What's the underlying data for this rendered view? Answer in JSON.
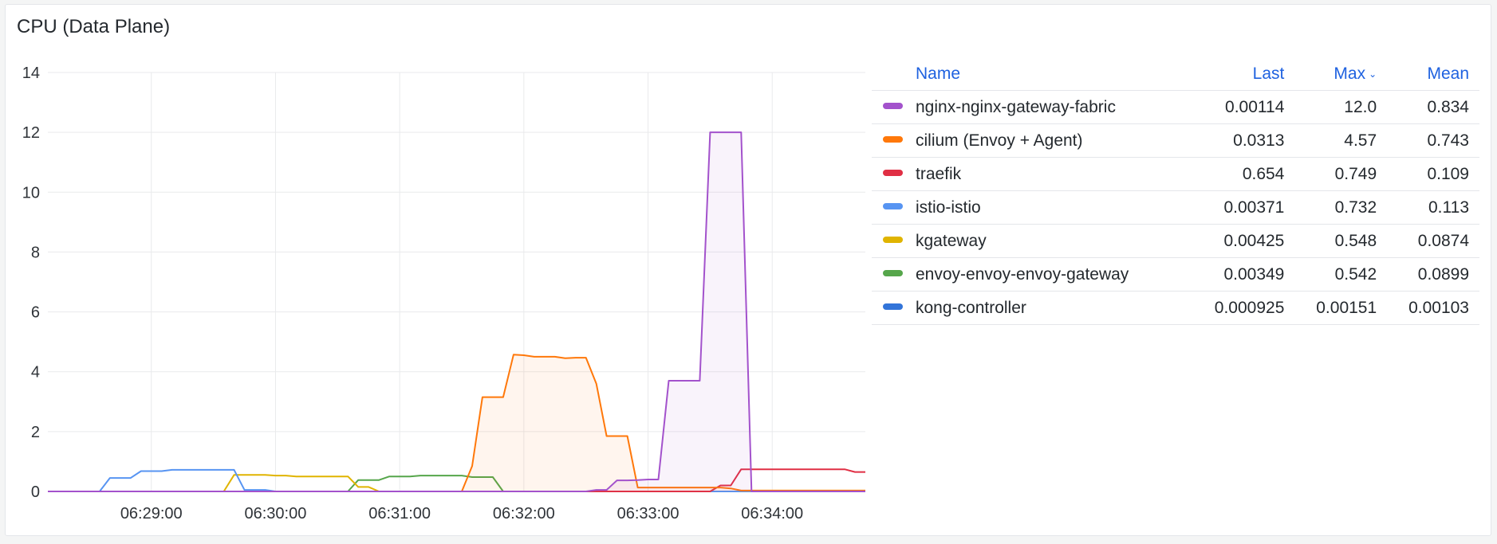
{
  "panel": {
    "title": "CPU (Data Plane)"
  },
  "legend": {
    "headers": {
      "name": "Name",
      "last": "Last",
      "max": "Max",
      "mean": "Mean"
    },
    "sort_icon": "chevron-down-icon"
  },
  "chart_data": {
    "type": "line",
    "title": "CPU (Data Plane)",
    "xlabel": "",
    "ylabel": "",
    "ylim": [
      0,
      14
    ],
    "yticks": [
      0,
      2,
      4,
      6,
      8,
      10,
      12,
      14
    ],
    "xlim": [
      "06:28:10",
      "06:34:45"
    ],
    "xticks": [
      "06:29:00",
      "06:30:00",
      "06:31:00",
      "06:32:00",
      "06:33:00",
      "06:34:00"
    ],
    "grid": true,
    "legend_placement": "right",
    "series": [
      {
        "name": "nginx-nginx-gateway-fabric",
        "color": "#a352cc",
        "fill": true,
        "last": "0.00114",
        "max": "12.0",
        "mean": "0.834",
        "points": [
          [
            "06:28:10",
            0
          ],
          [
            "06:32:30",
            0
          ],
          [
            "06:32:35",
            0.05
          ],
          [
            "06:32:40",
            0.05
          ],
          [
            "06:32:45",
            0.37
          ],
          [
            "06:32:50",
            0.37
          ],
          [
            "06:32:55",
            0.38
          ],
          [
            "06:33:00",
            0.4
          ],
          [
            "06:33:05",
            0.4
          ],
          [
            "06:33:10",
            3.7
          ],
          [
            "06:33:15",
            3.7
          ],
          [
            "06:33:20",
            3.7
          ],
          [
            "06:33:25",
            3.7
          ],
          [
            "06:33:30",
            12.0
          ],
          [
            "06:33:35",
            12.0
          ],
          [
            "06:33:40",
            12.0
          ],
          [
            "06:33:45",
            12.0
          ],
          [
            "06:33:50",
            0.0
          ],
          [
            "06:34:45",
            0.0
          ]
        ]
      },
      {
        "name": "cilium (Envoy + Agent)",
        "color": "#ff780a",
        "fill": true,
        "last": "0.0313",
        "max": "4.57",
        "mean": "0.743",
        "points": [
          [
            "06:28:10",
            0
          ],
          [
            "06:31:30",
            0
          ],
          [
            "06:31:35",
            0.85
          ],
          [
            "06:31:40",
            3.15
          ],
          [
            "06:31:45",
            3.15
          ],
          [
            "06:31:50",
            3.15
          ],
          [
            "06:31:55",
            4.57
          ],
          [
            "06:32:00",
            4.55
          ],
          [
            "06:32:05",
            4.5
          ],
          [
            "06:32:10",
            4.5
          ],
          [
            "06:32:15",
            4.5
          ],
          [
            "06:32:20",
            4.45
          ],
          [
            "06:32:25",
            4.47
          ],
          [
            "06:32:30",
            4.47
          ],
          [
            "06:32:35",
            3.6
          ],
          [
            "06:32:40",
            1.85
          ],
          [
            "06:32:45",
            1.85
          ],
          [
            "06:32:50",
            1.85
          ],
          [
            "06:32:55",
            0.13
          ],
          [
            "06:33:00",
            0.13
          ],
          [
            "06:33:35",
            0.13
          ],
          [
            "06:33:40",
            0.1
          ],
          [
            "06:33:45",
            0.03
          ],
          [
            "06:34:45",
            0.03
          ]
        ]
      },
      {
        "name": "traefik",
        "color": "#e02f44",
        "fill": false,
        "last": "0.654",
        "max": "0.749",
        "mean": "0.109",
        "points": [
          [
            "06:28:10",
            0
          ],
          [
            "06:33:30",
            0
          ],
          [
            "06:33:35",
            0.2
          ],
          [
            "06:33:40",
            0.2
          ],
          [
            "06:33:45",
            0.74
          ],
          [
            "06:34:35",
            0.74
          ],
          [
            "06:34:40",
            0.65
          ],
          [
            "06:34:45",
            0.65
          ]
        ]
      },
      {
        "name": "istio-istio",
        "color": "#5794f2",
        "fill": false,
        "last": "0.00371",
        "max": "0.732",
        "mean": "0.113",
        "points": [
          [
            "06:28:10",
            0
          ],
          [
            "06:28:35",
            0
          ],
          [
            "06:28:40",
            0.45
          ],
          [
            "06:28:45",
            0.45
          ],
          [
            "06:28:50",
            0.45
          ],
          [
            "06:28:55",
            0.68
          ],
          [
            "06:29:00",
            0.68
          ],
          [
            "06:29:05",
            0.68
          ],
          [
            "06:29:10",
            0.72
          ],
          [
            "06:29:40",
            0.72
          ],
          [
            "06:29:45",
            0.05
          ],
          [
            "06:29:55",
            0.05
          ],
          [
            "06:30:00",
            0
          ],
          [
            "06:34:45",
            0
          ]
        ]
      },
      {
        "name": "kgateway",
        "color": "#e0b400",
        "fill": false,
        "last": "0.00425",
        "max": "0.548",
        "mean": "0.0874",
        "points": [
          [
            "06:28:10",
            0
          ],
          [
            "06:29:35",
            0
          ],
          [
            "06:29:40",
            0.55
          ],
          [
            "06:29:55",
            0.55
          ],
          [
            "06:30:00",
            0.53
          ],
          [
            "06:30:05",
            0.53
          ],
          [
            "06:30:10",
            0.5
          ],
          [
            "06:30:35",
            0.5
          ],
          [
            "06:30:40",
            0.15
          ],
          [
            "06:30:45",
            0.15
          ],
          [
            "06:30:50",
            0
          ],
          [
            "06:34:45",
            0
          ]
        ]
      },
      {
        "name": "envoy-envoy-envoy-gateway",
        "color": "#56a64b",
        "fill": false,
        "last": "0.00349",
        "max": "0.542",
        "mean": "0.0899",
        "points": [
          [
            "06:28:10",
            0
          ],
          [
            "06:30:35",
            0
          ],
          [
            "06:30:40",
            0.38
          ],
          [
            "06:30:50",
            0.38
          ],
          [
            "06:30:55",
            0.5
          ],
          [
            "06:31:05",
            0.5
          ],
          [
            "06:31:10",
            0.53
          ],
          [
            "06:31:30",
            0.53
          ],
          [
            "06:31:35",
            0.48
          ],
          [
            "06:31:45",
            0.48
          ],
          [
            "06:31:50",
            0
          ],
          [
            "06:34:45",
            0
          ]
        ]
      },
      {
        "name": "kong-controller",
        "color": "#3274d9",
        "fill": false,
        "last": "0.000925",
        "max": "0.00151",
        "mean": "0.00103",
        "points": [
          [
            "06:28:10",
            0.001
          ],
          [
            "06:34:45",
            0.001
          ]
        ]
      }
    ]
  }
}
